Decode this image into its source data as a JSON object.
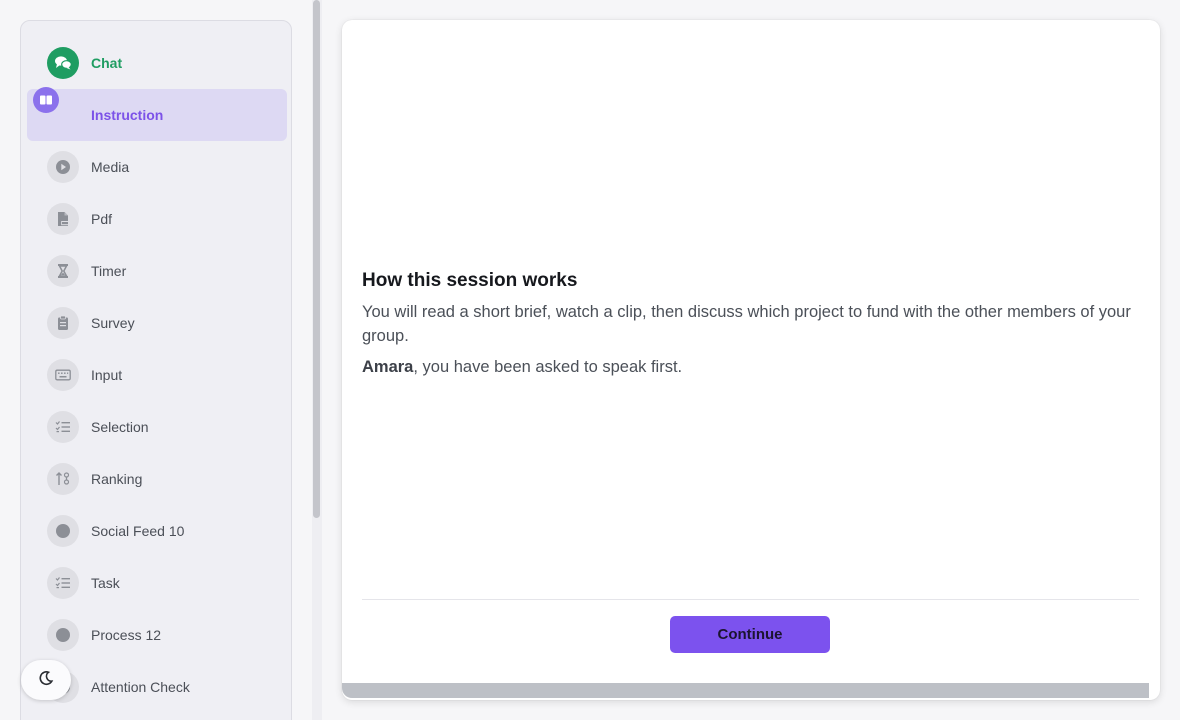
{
  "sidebar": {
    "items": [
      {
        "label": "Chat",
        "icon": "chat-bubbles-icon",
        "state": "completed"
      },
      {
        "label": "Instruction",
        "icon": "book-icon",
        "state": "active"
      },
      {
        "label": "Media",
        "icon": "play-icon"
      },
      {
        "label": "Pdf",
        "icon": "pdf-file-icon"
      },
      {
        "label": "Timer",
        "icon": "hourglass-icon"
      },
      {
        "label": "Survey",
        "icon": "clipboard-icon"
      },
      {
        "label": "Input",
        "icon": "keyboard-icon"
      },
      {
        "label": "Selection",
        "icon": "checklist-icon"
      },
      {
        "label": "Ranking",
        "icon": "sort-icon"
      },
      {
        "label": "Social Feed 10",
        "icon": "dot-icon"
      },
      {
        "label": "Task",
        "icon": "checklist-icon"
      },
      {
        "label": "Process 12",
        "icon": "dot-icon"
      },
      {
        "label": "Attention Check",
        "icon": "dot-icon"
      }
    ]
  },
  "theme_toggle": {
    "icon": "moon-icon"
  },
  "main": {
    "title": "How this session works",
    "paragraph": "You will read a short brief, watch a clip, then discuss which project to fund with the other members of your group.",
    "speaker_name": "Amara",
    "speaker_text": ", you have been asked to speak first.",
    "continue_label": "Continue"
  },
  "colors": {
    "accent": "#7c52ee",
    "active_bg": "#ddd9f3",
    "completed": "#1f9d62"
  }
}
